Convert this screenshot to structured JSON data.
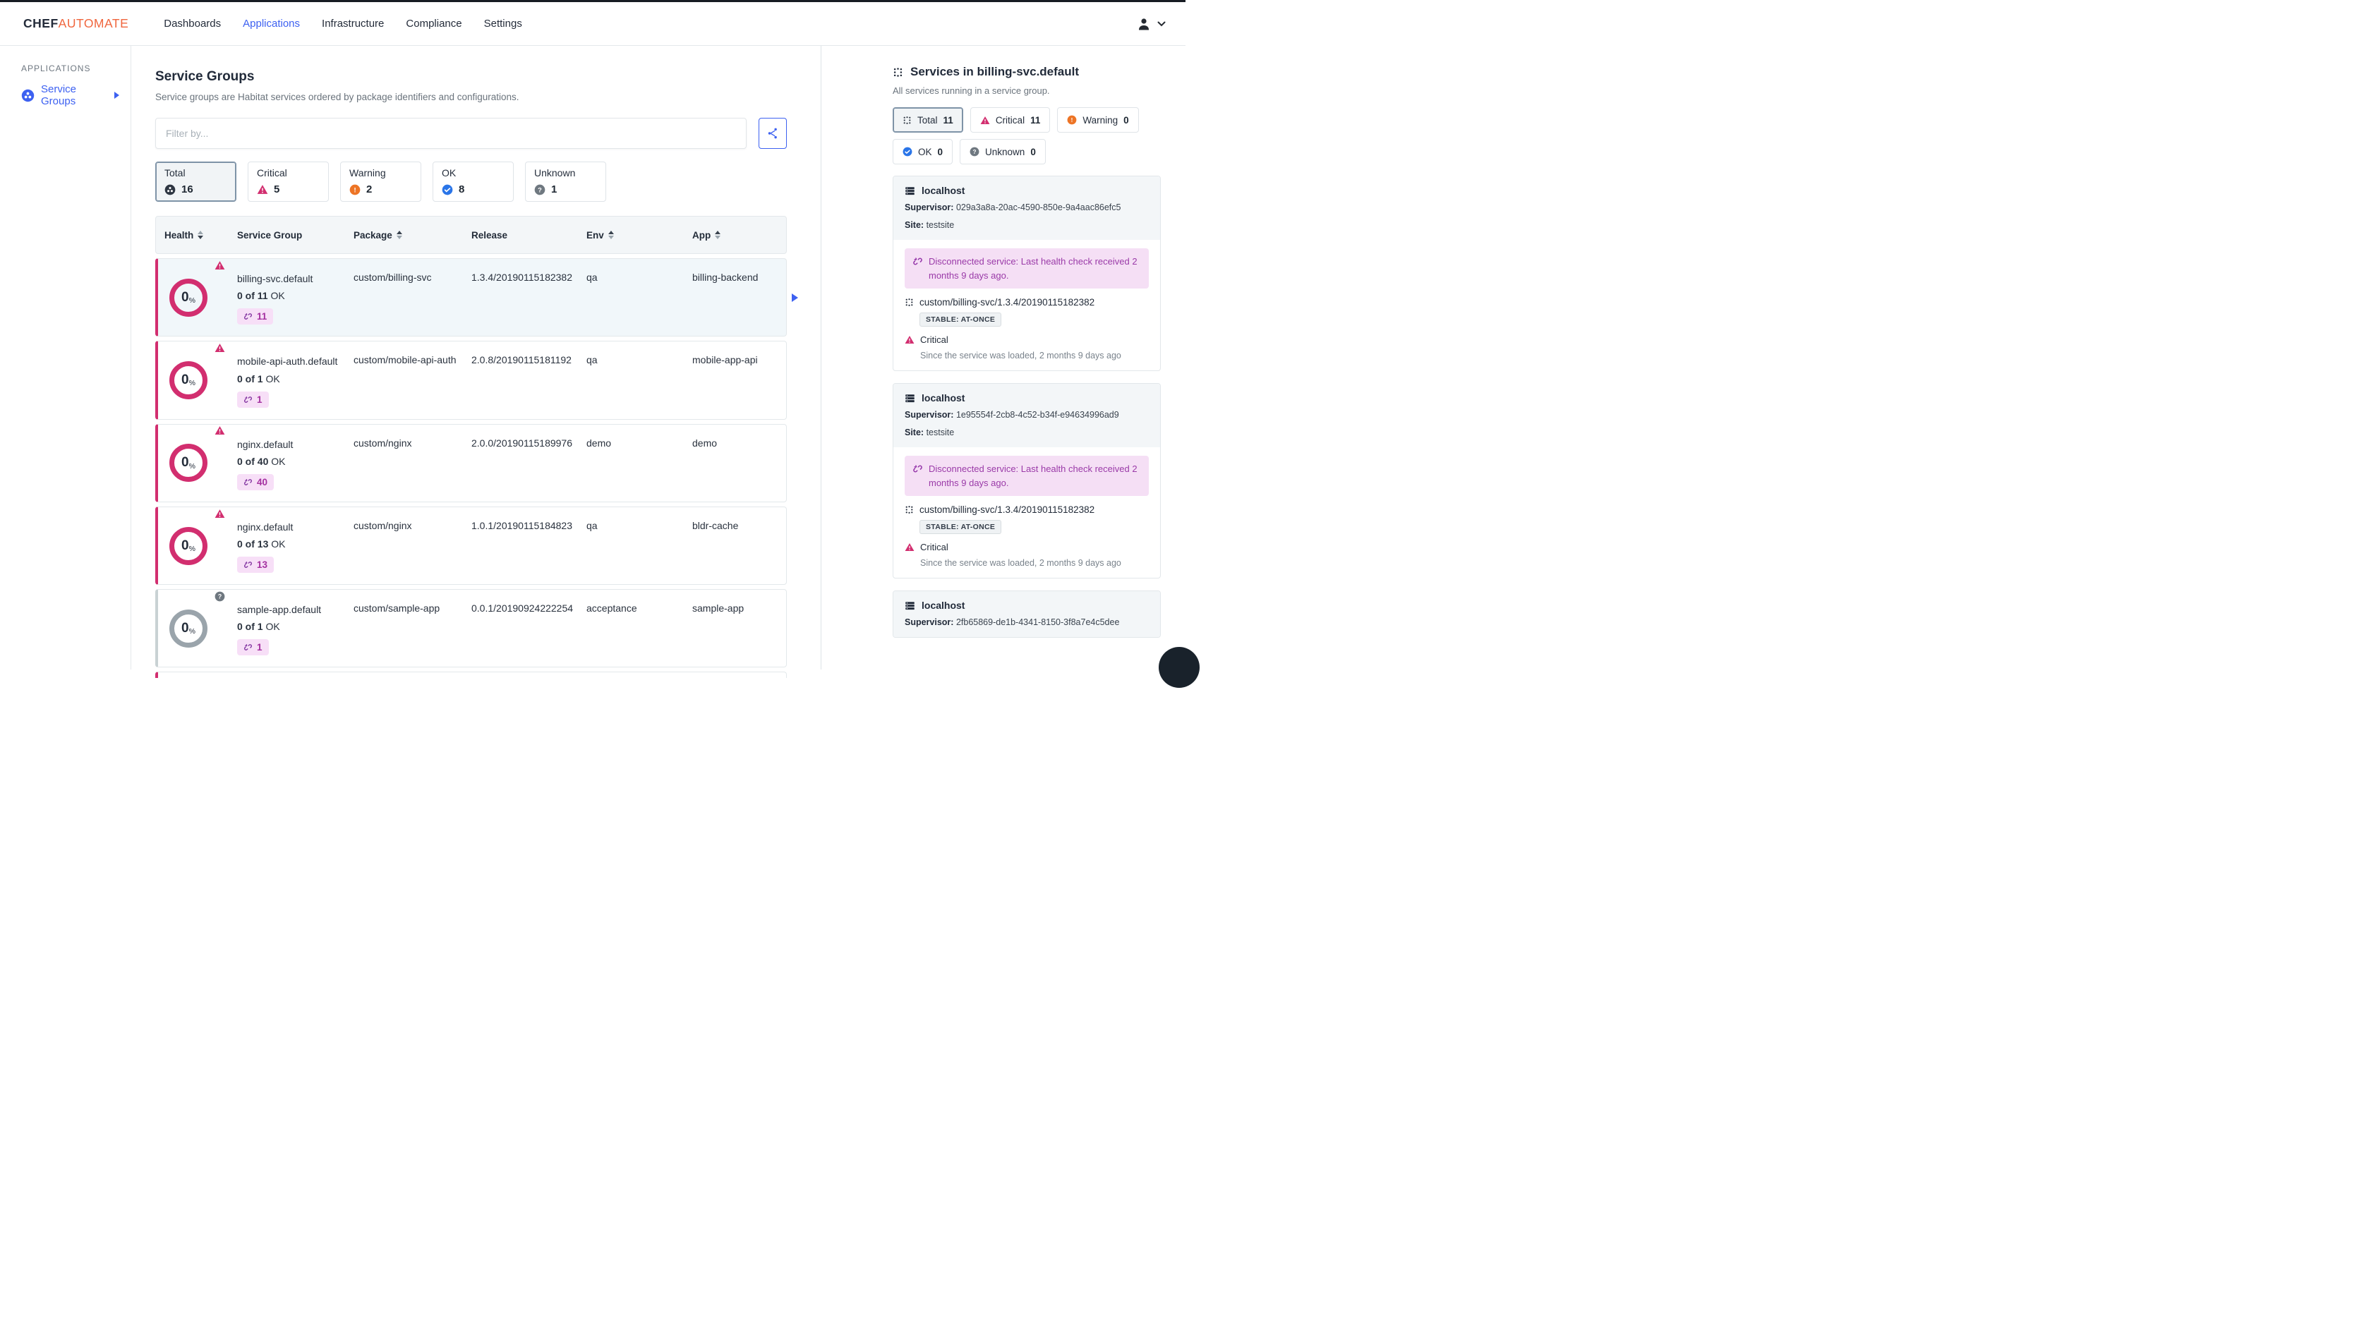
{
  "colors": {
    "accent_blue": "#3D61F1",
    "critical_pink": "#D22E6F",
    "warning_orange": "#ED7425",
    "ok_blue": "#2A75E8",
    "unknown_gray": "#6F7880",
    "disconnected_purple": "#9A3AA8",
    "brand_orange": "#F0663E"
  },
  "icons": {
    "exclamation": "!",
    "question": "?",
    "percent": "%"
  },
  "navbar": {
    "logo": {
      "chef": "CHEF",
      "automate": "AUTOMATE"
    },
    "items": [
      {
        "label": "Dashboards"
      },
      {
        "label": "Applications"
      },
      {
        "label": "Infrastructure"
      },
      {
        "label": "Compliance"
      },
      {
        "label": "Settings"
      }
    ]
  },
  "sidebar": {
    "heading": "APPLICATIONS",
    "service_groups_label": "Service Groups"
  },
  "main": {
    "title": "Service Groups",
    "subtitle": "Service groups are Habitat services ordered by package identifiers and configurations.",
    "filter_placeholder": "Filter by...",
    "status_cards": [
      {
        "label": "Total",
        "count": "16"
      },
      {
        "label": "Critical",
        "count": "5"
      },
      {
        "label": "Warning",
        "count": "2"
      },
      {
        "label": "OK",
        "count": "8"
      },
      {
        "label": "Unknown",
        "count": "1"
      }
    ],
    "table": {
      "columns": [
        {
          "label": "Health"
        },
        {
          "label": "Service Group"
        },
        {
          "label": "Package"
        },
        {
          "label": "Release"
        },
        {
          "label": "Env"
        },
        {
          "label": "App"
        }
      ],
      "rows": [
        {
          "health": "0",
          "name": "billing-svc.default",
          "ok_bold": "0 of 11",
          "ok_rest": "OK",
          "badge": "11",
          "package": "custom/billing-svc",
          "release": "1.3.4/20190115182382",
          "env": "qa",
          "app": "billing-backend"
        },
        {
          "health": "0",
          "name": "mobile-api-auth.default",
          "ok_bold": "0 of 1",
          "ok_rest": "OK",
          "badge": "1",
          "package": "custom/mobile-api-auth",
          "release": "2.0.8/20190115181192",
          "env": "qa",
          "app": "mobile-app-api"
        },
        {
          "health": "0",
          "name": "nginx.default",
          "ok_bold": "0 of 40",
          "ok_rest": "OK",
          "badge": "40",
          "package": "custom/nginx",
          "release": "2.0.0/20190115189976",
          "env": "demo",
          "app": "demo"
        },
        {
          "health": "0",
          "name": "nginx.default",
          "ok_bold": "0 of 13",
          "ok_rest": "OK",
          "badge": "13",
          "package": "custom/nginx",
          "release": "1.0.1/20190115184823",
          "env": "qa",
          "app": "bldr-cache"
        },
        {
          "health": "0",
          "name": "sample-app.default",
          "ok_bold": "0 of 1",
          "ok_rest": "OK",
          "badge": "1",
          "package": "custom/sample-app",
          "release": "0.0.1/20190924222254",
          "env": "acceptance",
          "app": "sample-app"
        }
      ]
    }
  },
  "panel": {
    "title": "Services in billing-svc.default",
    "subtitle": "All services running in a service group.",
    "chips": [
      {
        "label": "Total",
        "count": "11"
      },
      {
        "label": "Critical",
        "count": "11"
      },
      {
        "label": "Warning",
        "count": "0"
      },
      {
        "label": "OK",
        "count": "0"
      },
      {
        "label": "Unknown",
        "count": "0"
      }
    ],
    "cards": [
      {
        "host": "localhost",
        "supervisor_label": "Supervisor:",
        "supervisor": "029a3a8a-20ac-4590-850e-9a4aac86efc5",
        "site_label": "Site:",
        "site": "testsite",
        "banner": "Disconnected service: Last health check received 2 months 9 days ago.",
        "package": "custom/billing-svc/1.3.4/20190115182382",
        "tag": "STABLE: AT-ONCE",
        "status": "Critical",
        "since": "Since the service was loaded, 2 months 9 days ago"
      },
      {
        "host": "localhost",
        "supervisor_label": "Supervisor:",
        "supervisor": "1e95554f-2cb8-4c52-b34f-e94634996ad9",
        "site_label": "Site:",
        "site": "testsite",
        "banner": "Disconnected service: Last health check received 2 months 9 days ago.",
        "package": "custom/billing-svc/1.3.4/20190115182382",
        "tag": "STABLE: AT-ONCE",
        "status": "Critical",
        "since": "Since the service was loaded, 2 months 9 days ago"
      },
      {
        "host": "localhost",
        "supervisor_label": "Supervisor:",
        "supervisor": "2fb65869-de1b-4341-8150-3f8a7e4c5dee"
      }
    ]
  }
}
